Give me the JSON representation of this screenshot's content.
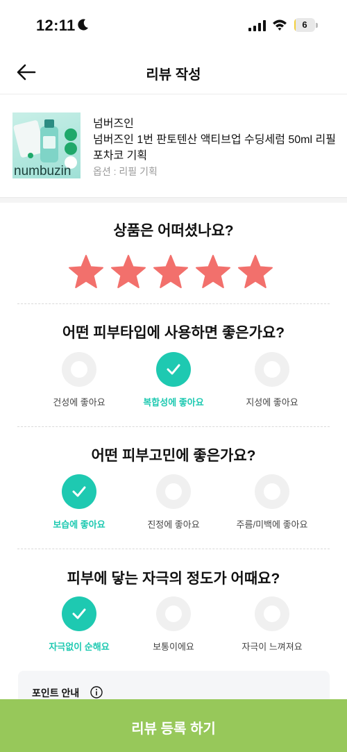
{
  "status_bar": {
    "time": "12:11",
    "battery": "6",
    "battery_level": 0.06
  },
  "header": {
    "title": "리뷰 작성"
  },
  "product": {
    "brand": "넘버즈인",
    "name": "넘버즈인 1번 판토텐산 액티브업 수딩세럼 50ml 리필 포차코 기획",
    "option": "옵션 : 리필 기획",
    "image_logo": "numbuzin"
  },
  "rating": {
    "question": "상품은 어떠셨나요?",
    "stars": 5,
    "star_color": "#f2706c"
  },
  "skin_type": {
    "question": "어떤 피부타입에 사용하면 좋은가요?",
    "options": [
      "건성에 좋아요",
      "복합성에 좋아요",
      "지성에 좋아요"
    ],
    "selected_index": 1
  },
  "skin_concern": {
    "question": "어떤 피부고민에 좋은가요?",
    "options": [
      "보습에 좋아요",
      "진정에 좋아요",
      "주름/미백에 좋아요"
    ],
    "selected_index": 0
  },
  "irritation": {
    "question": "피부에 닿는 자극의 정도가 어때요?",
    "options": [
      "자극없이 순해요",
      "보통이에요",
      "자극이 느껴져요"
    ],
    "selected_index": 0
  },
  "point_notice": {
    "title": "포인트 안내"
  },
  "submit": {
    "label": "리뷰 등록 하기"
  },
  "colors": {
    "accent": "#1ec9b1",
    "submit_bg": "#97c85a",
    "star": "#f2706c"
  },
  "icons": [
    "moon-icon",
    "signal-icon",
    "wifi-icon",
    "back-icon",
    "star-icon",
    "check-icon",
    "info-icon"
  ]
}
